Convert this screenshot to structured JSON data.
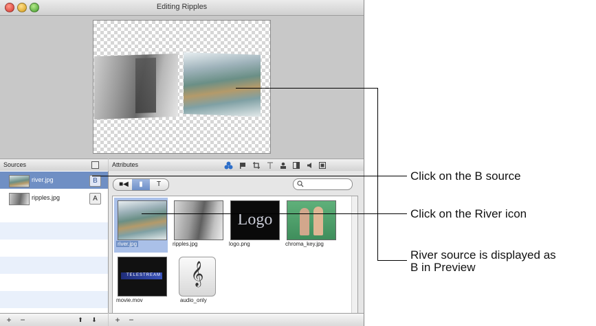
{
  "window": {
    "title": "Editing Ripples",
    "colors": {
      "selection": "#6f8fc4",
      "accent_blue": "#2d6ec9"
    }
  },
  "sources_panel": {
    "header": "Sources",
    "items": [
      {
        "label": "river.jpg",
        "tag": "B",
        "selected": true
      },
      {
        "label": "ripples.jpg",
        "tag": "A",
        "selected": false
      }
    ],
    "bottom_buttons": [
      "+",
      "−",
      "⬆",
      "⬇"
    ]
  },
  "attributes_panel": {
    "header": "Attributes",
    "segment_tabs": [
      "■◀",
      "▮",
      "T"
    ],
    "search_placeholder": "",
    "icons": [
      "layers-icon",
      "flag-icon",
      "crop-icon",
      "text-icon",
      "person-icon",
      "split-icon",
      "speaker-icon",
      "fit-icon"
    ],
    "items": [
      {
        "label": "river.jpg",
        "selected": true
      },
      {
        "label": "ripples.jpg",
        "selected": false
      },
      {
        "label": "logo.png",
        "selected": false
      },
      {
        "label": "chroma_key.jpg",
        "selected": false
      },
      {
        "label": "movie.mov",
        "selected": false
      },
      {
        "label": "audio_only",
        "selected": false
      }
    ],
    "logo_text": "Logo",
    "movie_text": "TELESTREAM",
    "audio_glyph": "𝄞",
    "bottom_buttons": [
      "+",
      "−"
    ]
  },
  "callouts": {
    "b_source": "Click on the B source",
    "river_icon": "Click on the River icon",
    "preview_line1": "River source is displayed as",
    "preview_line2": "B in Preview"
  }
}
